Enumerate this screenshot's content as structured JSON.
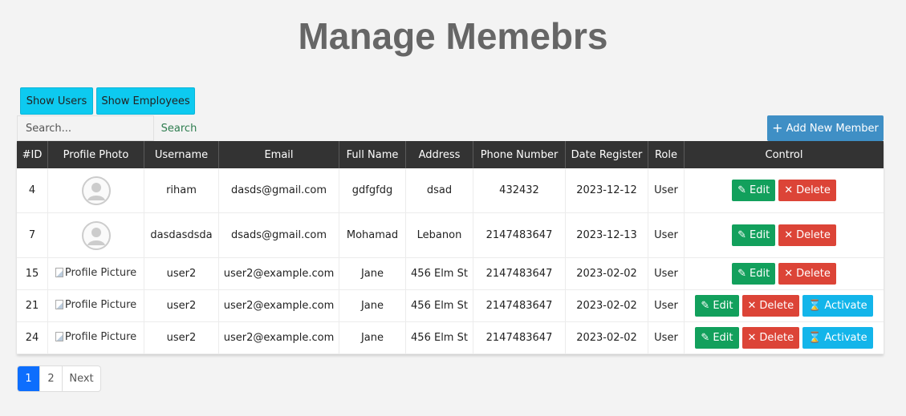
{
  "page": {
    "title": "Manage Memebrs"
  },
  "toolbar": {
    "show_users": "Show Users",
    "show_employees": "Show Employees",
    "search_placeholder": "Search...",
    "search_button": "Search",
    "add_member": "Add New Member"
  },
  "table": {
    "headers": [
      "#ID",
      "Profile Photo",
      "Username",
      "Email",
      "Full Name",
      "Address",
      "Phone Number",
      "Date Register",
      "Role",
      "Control"
    ],
    "rows": [
      {
        "id": "4",
        "photo": "avatar-icon",
        "username": "riham",
        "email": "dasds@gmail.com",
        "full_name": "gdfgfdg",
        "address": "dsad",
        "phone": "432432",
        "date": "2023-12-12",
        "role": "User"
      },
      {
        "id": "7",
        "photo": "avatar-icon",
        "username": "dasdasdsda",
        "email": "dsads@gmail.com",
        "full_name": "Mohamad",
        "address": "Lebanon",
        "phone": "2147483647",
        "date": "2023-12-13",
        "role": "User"
      },
      {
        "id": "15",
        "photo_alt": "Profile Picture",
        "username": "user2",
        "email": "user2@example.com",
        "full_name": "Jane",
        "address": "456 Elm St",
        "phone": "2147483647",
        "date": "2023-02-02",
        "role": "User"
      },
      {
        "id": "21",
        "photo_alt": "Profile Picture",
        "username": "user2",
        "email": "user2@example.com",
        "full_name": "Jane",
        "address": "456 Elm St",
        "phone": "2147483647",
        "date": "2023-02-02",
        "role": "User"
      },
      {
        "id": "24",
        "photo_alt": "Profile Picture",
        "username": "user2",
        "email": "user2@example.com",
        "full_name": "Jane",
        "address": "456 Elm St",
        "phone": "2147483647",
        "date": "2023-02-02",
        "role": "User"
      }
    ],
    "edit_label": "Edit",
    "delete_label": "Delete",
    "activate_label": "Activate"
  },
  "pagination": {
    "pages": [
      "1",
      "2"
    ],
    "next": "Next"
  },
  "colors": {
    "header_bg": "#333333",
    "edit": "#12a05c",
    "delete": "#dc4437",
    "activate": "#13b5ea",
    "add": "#3f8fc5",
    "info": "#0dcaf0"
  }
}
